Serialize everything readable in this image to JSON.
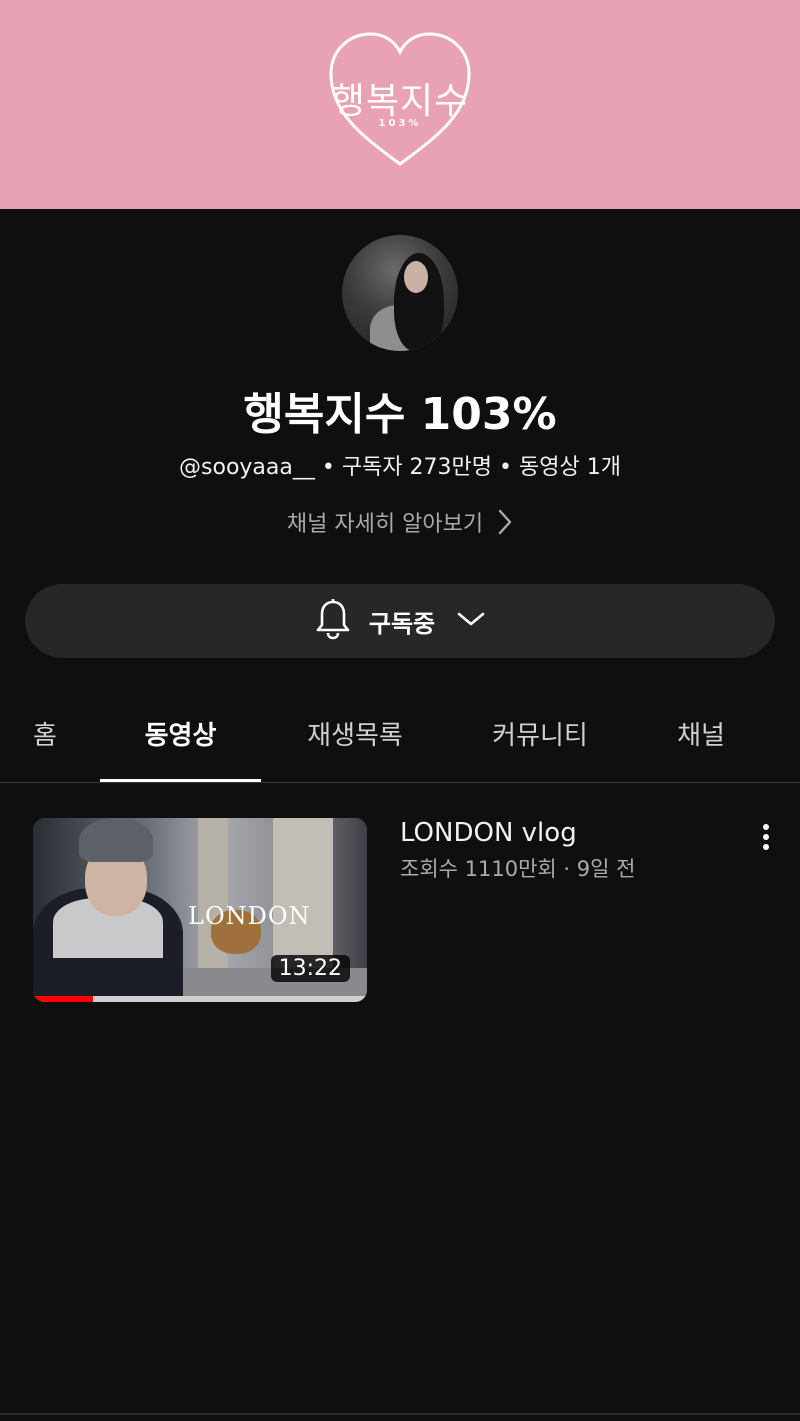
{
  "banner": {
    "logo_text": "행복지수",
    "logo_sub": "103%",
    "bg_color": "#e8a2b4"
  },
  "channel": {
    "name": "행복지수 103%",
    "meta": "@sooyaaa__ • 구독자 273만명 • 동영상 1개",
    "more_link": "채널 자세히 알아보기"
  },
  "subscribe": {
    "label": "구독중",
    "icons": [
      "bell-icon",
      "chevron-down-icon"
    ]
  },
  "tabs": [
    {
      "label": "홈",
      "active": false
    },
    {
      "label": "동영상",
      "active": true
    },
    {
      "label": "재생목록",
      "active": false
    },
    {
      "label": "커뮤니티",
      "active": false
    },
    {
      "label": "채널",
      "active": false
    }
  ],
  "videos": [
    {
      "title": "LONDON vlog",
      "meta": "조회수 1110만회 · 9일 전",
      "duration": "13:22",
      "thumb_overlay": "LONDON",
      "watched_fraction": 0.18
    }
  ],
  "colors": {
    "background": "#0f0f0f",
    "button_bg": "#272727",
    "progress": "#ff0000"
  }
}
